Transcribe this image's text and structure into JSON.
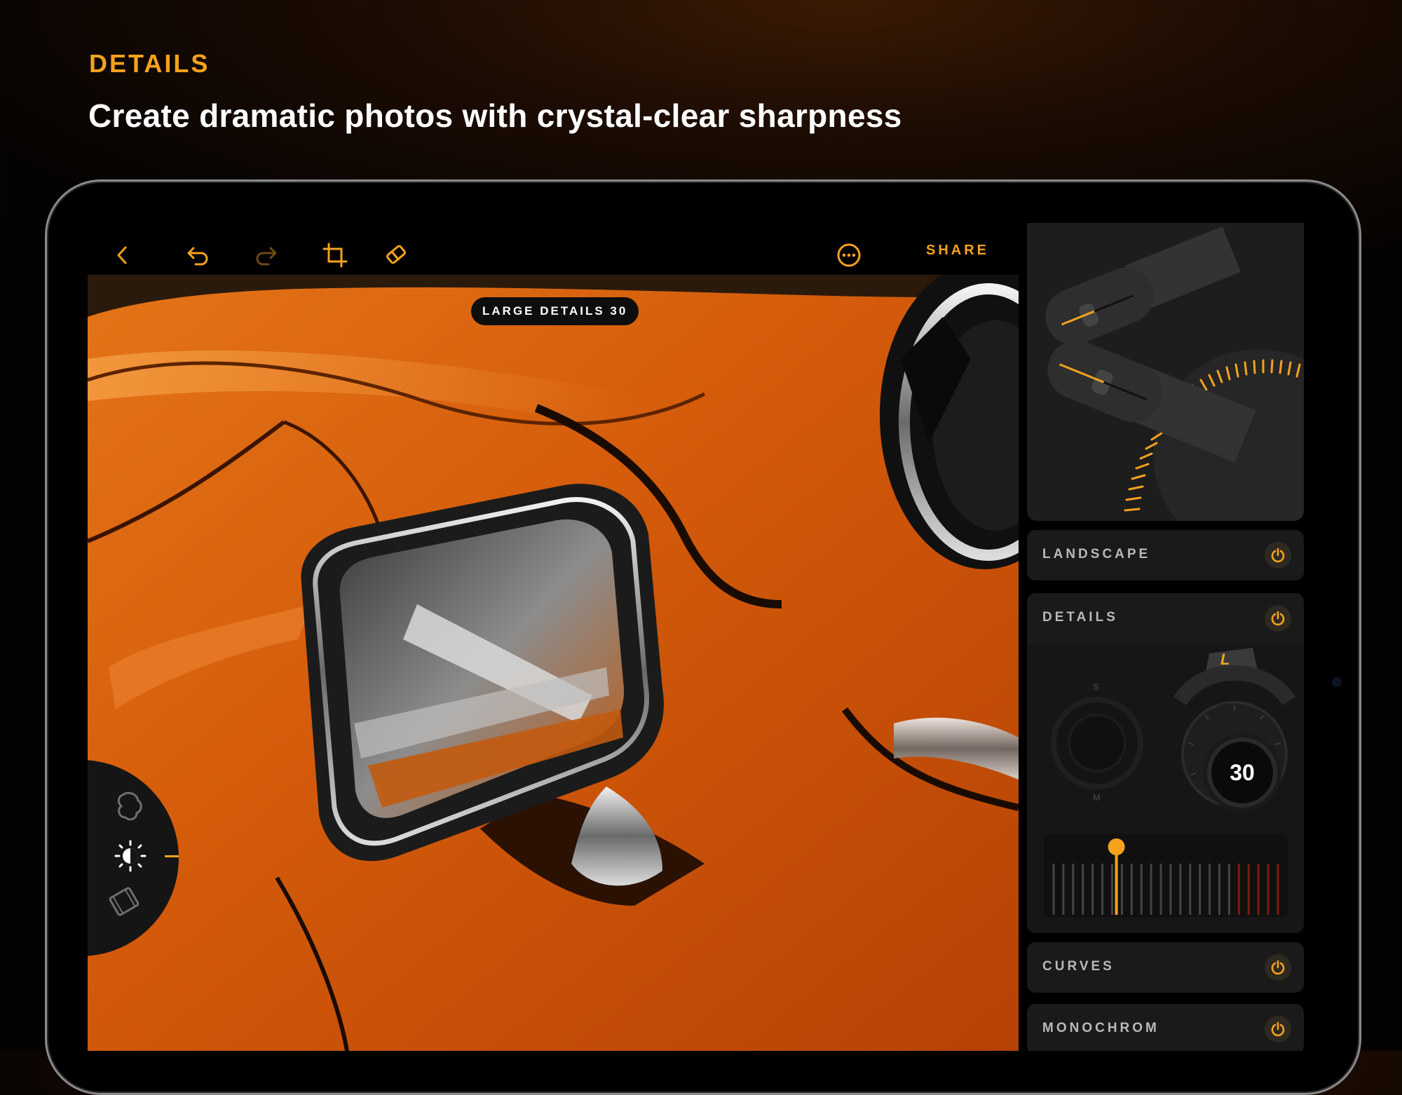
{
  "header": {
    "eyebrow": "DETAILS",
    "headline": "Create dramatic photos with crystal-clear sharpness"
  },
  "toolbar": {
    "icons": [
      "back-icon",
      "undo-icon",
      "redo-icon",
      "crop-icon",
      "eraser-icon",
      "more-icon"
    ],
    "share_label": "SHARE"
  },
  "photo": {
    "badge": "LARGE DETAILS 30"
  },
  "tools": [
    "mask-icon",
    "adjust-icon",
    "film-icon"
  ],
  "panel": {
    "rows": {
      "landscape": "LANDSCAPE",
      "details": "DETAILS",
      "curves": "CURVES",
      "monochrom": "MONOCHROM"
    },
    "details_control": {
      "value": "30",
      "active_tab": "L",
      "tab_s": "S",
      "tab_m": "M",
      "slider_position_fraction": 0.28
    }
  },
  "colors": {
    "accent": "#f5a21e",
    "paint": "#d9600a",
    "panel": "#1a1a1a"
  }
}
